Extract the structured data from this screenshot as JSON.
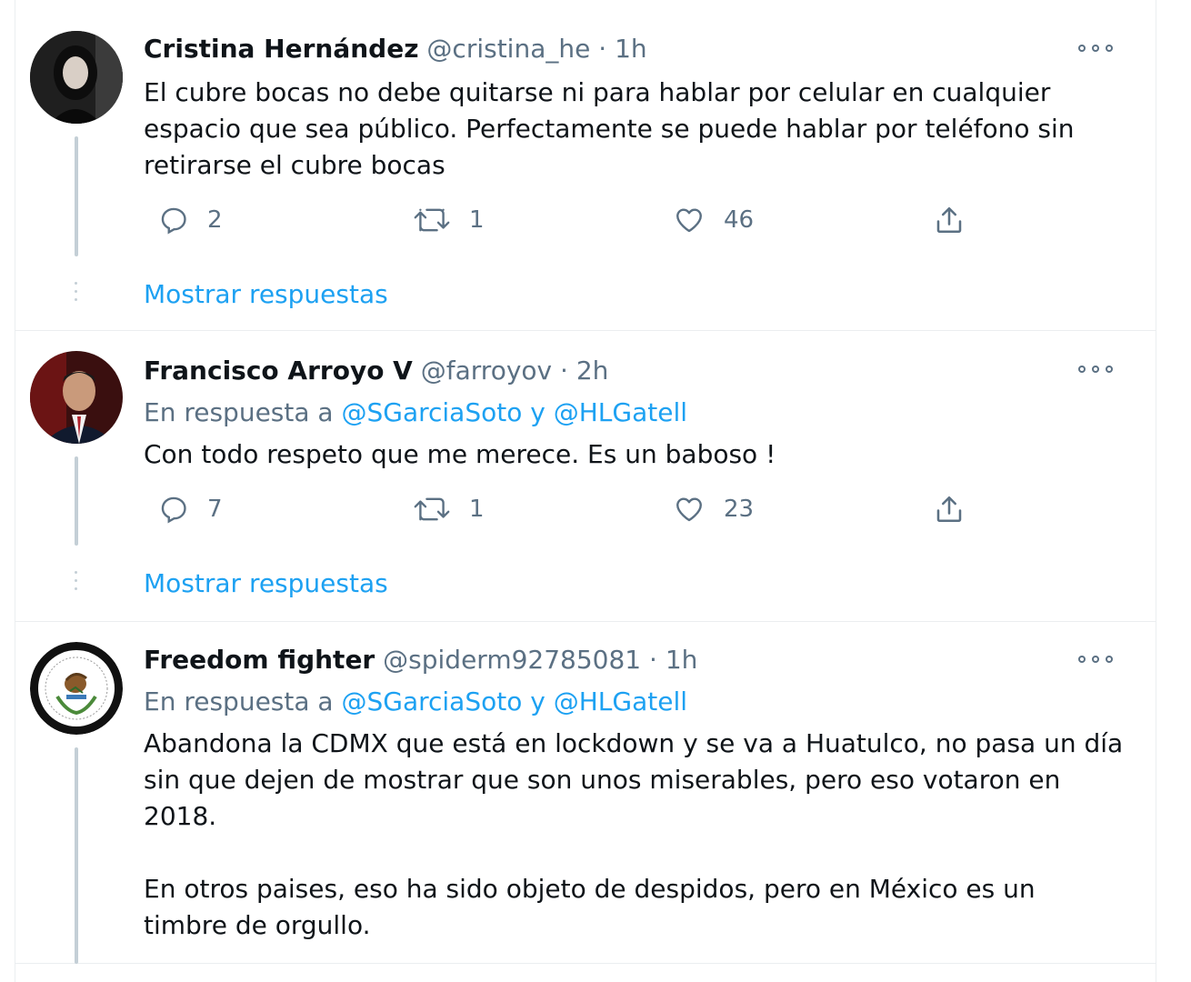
{
  "tweets": [
    {
      "name": "Cristina Hernández",
      "handle": "@cristina_he",
      "time": "1h",
      "text": [
        "El cubre bocas no debe quitarse ni para hablar por celular en cualquier espacio que sea público. Perfectamente se puede hablar por teléfono sin retirarse el cubre bocas"
      ],
      "replies": "2",
      "retweets": "1",
      "likes": "46",
      "show_replies": "Mostrar respuestas"
    },
    {
      "name": "Francisco Arroyo V",
      "handle": "@farroyov",
      "time": "2h",
      "reply_prefix": "En respuesta a",
      "reply_mentions": "@SGarciaSoto y @HLGatell",
      "text": [
        "Con todo respeto que me merece. Es un baboso !"
      ],
      "replies": "7",
      "retweets": "1",
      "likes": "23",
      "show_replies": "Mostrar respuestas"
    },
    {
      "name": "Freedom fighter",
      "handle": "@spiderm92785081",
      "time": "1h",
      "reply_prefix": "En respuesta a",
      "reply_mentions": "@SGarciaSoto y @HLGatell",
      "text": [
        "Abandona la CDMX que está en lockdown y se va a Huatulco, no pasa un día sin que dejen de mostrar que son unos miserables, pero eso votaron en 2018.",
        "En otros paises, eso ha sido objeto de despidos, pero en México es un timbre de orgullo."
      ]
    }
  ],
  "separator": "·",
  "colors": {
    "accent": "#1da1f2",
    "secondary_text": "#5b7083",
    "border": "#ebeef0",
    "thread_line": "#c4cfd6"
  },
  "icons": [
    "reply-icon",
    "retweet-icon",
    "like-icon",
    "share-icon",
    "more-options-icon"
  ]
}
